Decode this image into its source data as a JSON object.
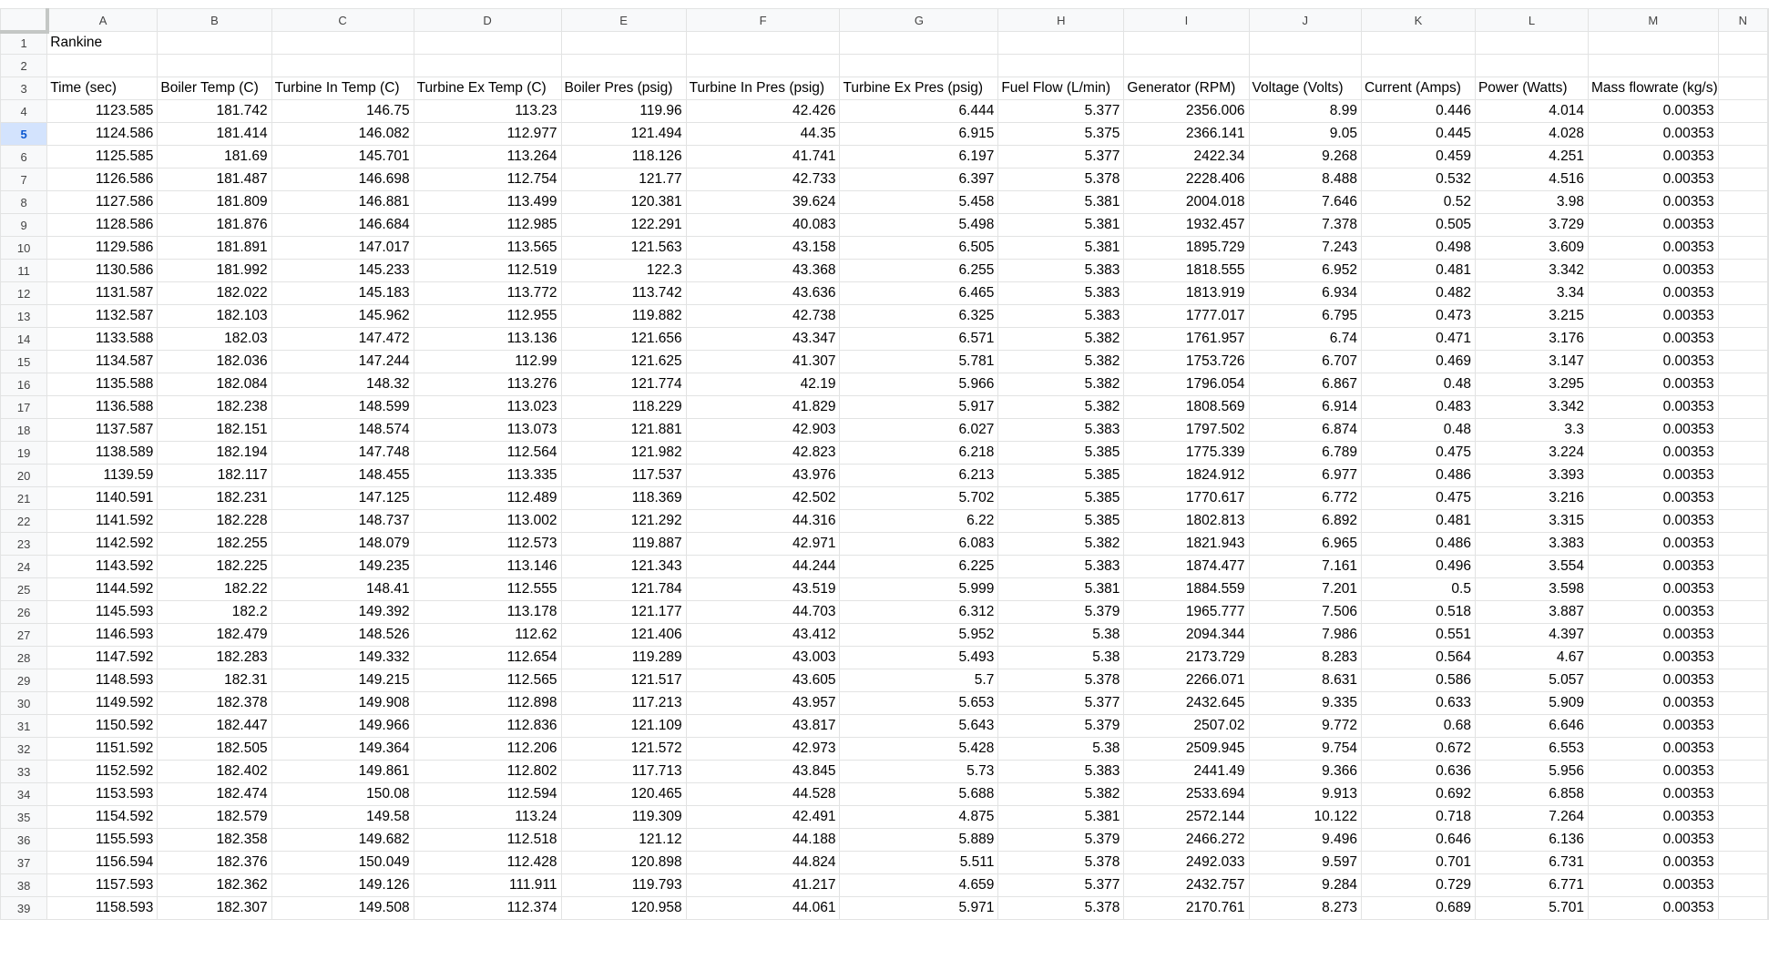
{
  "sheet": {
    "columns": [
      "A",
      "B",
      "C",
      "D",
      "E",
      "F",
      "G",
      "H",
      "I",
      "J",
      "K",
      "L",
      "M",
      "N"
    ],
    "selected_row": "5",
    "title_cell": "Rankine",
    "headers": [
      "Time (sec)",
      "Boiler Temp (C)",
      "Turbine In Temp (C)",
      "Turbine Ex Temp (C)",
      "Boiler Pres (psig)",
      "Turbine In Pres (psig)",
      "Turbine Ex Pres (psig)",
      "Fuel Flow (L/min)",
      "Generator (RPM)",
      "Voltage (Volts)",
      "Current (Amps)",
      "Power (Watts)",
      "Mass flowrate (kg/s)"
    ],
    "rows": [
      [
        "1123.585",
        "181.742",
        "146.75",
        "113.23",
        "119.96",
        "42.426",
        "6.444",
        "5.377",
        "2356.006",
        "8.99",
        "0.446",
        "4.014",
        "0.00353"
      ],
      [
        "1124.586",
        "181.414",
        "146.082",
        "112.977",
        "121.494",
        "44.35",
        "6.915",
        "5.375",
        "2366.141",
        "9.05",
        "0.445",
        "4.028",
        "0.00353"
      ],
      [
        "1125.585",
        "181.69",
        "145.701",
        "113.264",
        "118.126",
        "41.741",
        "6.197",
        "5.377",
        "2422.34",
        "9.268",
        "0.459",
        "4.251",
        "0.00353"
      ],
      [
        "1126.586",
        "181.487",
        "146.698",
        "112.754",
        "121.77",
        "42.733",
        "6.397",
        "5.378",
        "2228.406",
        "8.488",
        "0.532",
        "4.516",
        "0.00353"
      ],
      [
        "1127.586",
        "181.809",
        "146.881",
        "113.499",
        "120.381",
        "39.624",
        "5.458",
        "5.381",
        "2004.018",
        "7.646",
        "0.52",
        "3.98",
        "0.00353"
      ],
      [
        "1128.586",
        "181.876",
        "146.684",
        "112.985",
        "122.291",
        "40.083",
        "5.498",
        "5.381",
        "1932.457",
        "7.378",
        "0.505",
        "3.729",
        "0.00353"
      ],
      [
        "1129.586",
        "181.891",
        "147.017",
        "113.565",
        "121.563",
        "43.158",
        "6.505",
        "5.381",
        "1895.729",
        "7.243",
        "0.498",
        "3.609",
        "0.00353"
      ],
      [
        "1130.586",
        "181.992",
        "145.233",
        "112.519",
        "122.3",
        "43.368",
        "6.255",
        "5.383",
        "1818.555",
        "6.952",
        "0.481",
        "3.342",
        "0.00353"
      ],
      [
        "1131.587",
        "182.022",
        "145.183",
        "113.772",
        "113.742",
        "43.636",
        "6.465",
        "5.383",
        "1813.919",
        "6.934",
        "0.482",
        "3.34",
        "0.00353"
      ],
      [
        "1132.587",
        "182.103",
        "145.962",
        "112.955",
        "119.882",
        "42.738",
        "6.325",
        "5.383",
        "1777.017",
        "6.795",
        "0.473",
        "3.215",
        "0.00353"
      ],
      [
        "1133.588",
        "182.03",
        "147.472",
        "113.136",
        "121.656",
        "43.347",
        "6.571",
        "5.382",
        "1761.957",
        "6.74",
        "0.471",
        "3.176",
        "0.00353"
      ],
      [
        "1134.587",
        "182.036",
        "147.244",
        "112.99",
        "121.625",
        "41.307",
        "5.781",
        "5.382",
        "1753.726",
        "6.707",
        "0.469",
        "3.147",
        "0.00353"
      ],
      [
        "1135.588",
        "182.084",
        "148.32",
        "113.276",
        "121.774",
        "42.19",
        "5.966",
        "5.382",
        "1796.054",
        "6.867",
        "0.48",
        "3.295",
        "0.00353"
      ],
      [
        "1136.588",
        "182.238",
        "148.599",
        "113.023",
        "118.229",
        "41.829",
        "5.917",
        "5.382",
        "1808.569",
        "6.914",
        "0.483",
        "3.342",
        "0.00353"
      ],
      [
        "1137.587",
        "182.151",
        "148.574",
        "113.073",
        "121.881",
        "42.903",
        "6.027",
        "5.383",
        "1797.502",
        "6.874",
        "0.48",
        "3.3",
        "0.00353"
      ],
      [
        "1138.589",
        "182.194",
        "147.748",
        "112.564",
        "121.982",
        "42.823",
        "6.218",
        "5.385",
        "1775.339",
        "6.789",
        "0.475",
        "3.224",
        "0.00353"
      ],
      [
        "1139.59",
        "182.117",
        "148.455",
        "113.335",
        "117.537",
        "43.976",
        "6.213",
        "5.385",
        "1824.912",
        "6.977",
        "0.486",
        "3.393",
        "0.00353"
      ],
      [
        "1140.591",
        "182.231",
        "147.125",
        "112.489",
        "118.369",
        "42.502",
        "5.702",
        "5.385",
        "1770.617",
        "6.772",
        "0.475",
        "3.216",
        "0.00353"
      ],
      [
        "1141.592",
        "182.228",
        "148.737",
        "113.002",
        "121.292",
        "44.316",
        "6.22",
        "5.385",
        "1802.813",
        "6.892",
        "0.481",
        "3.315",
        "0.00353"
      ],
      [
        "1142.592",
        "182.255",
        "148.079",
        "112.573",
        "119.887",
        "42.971",
        "6.083",
        "5.382",
        "1821.943",
        "6.965",
        "0.486",
        "3.383",
        "0.00353"
      ],
      [
        "1143.592",
        "182.225",
        "149.235",
        "113.146",
        "121.343",
        "44.244",
        "6.225",
        "5.383",
        "1874.477",
        "7.161",
        "0.496",
        "3.554",
        "0.00353"
      ],
      [
        "1144.592",
        "182.22",
        "148.41",
        "112.555",
        "121.784",
        "43.519",
        "5.999",
        "5.381",
        "1884.559",
        "7.201",
        "0.5",
        "3.598",
        "0.00353"
      ],
      [
        "1145.593",
        "182.2",
        "149.392",
        "113.178",
        "121.177",
        "44.703",
        "6.312",
        "5.379",
        "1965.777",
        "7.506",
        "0.518",
        "3.887",
        "0.00353"
      ],
      [
        "1146.593",
        "182.479",
        "148.526",
        "112.62",
        "121.406",
        "43.412",
        "5.952",
        "5.38",
        "2094.344",
        "7.986",
        "0.551",
        "4.397",
        "0.00353"
      ],
      [
        "1147.592",
        "182.283",
        "149.332",
        "112.654",
        "119.289",
        "43.003",
        "5.493",
        "5.38",
        "2173.729",
        "8.283",
        "0.564",
        "4.67",
        "0.00353"
      ],
      [
        "1148.593",
        "182.31",
        "149.215",
        "112.565",
        "121.517",
        "43.605",
        "5.7",
        "5.378",
        "2266.071",
        "8.631",
        "0.586",
        "5.057",
        "0.00353"
      ],
      [
        "1149.592",
        "182.378",
        "149.908",
        "112.898",
        "117.213",
        "43.957",
        "5.653",
        "5.377",
        "2432.645",
        "9.335",
        "0.633",
        "5.909",
        "0.00353"
      ],
      [
        "1150.592",
        "182.447",
        "149.966",
        "112.836",
        "121.109",
        "43.817",
        "5.643",
        "5.379",
        "2507.02",
        "9.772",
        "0.68",
        "6.646",
        "0.00353"
      ],
      [
        "1151.592",
        "182.505",
        "149.364",
        "112.206",
        "121.572",
        "42.973",
        "5.428",
        "5.38",
        "2509.945",
        "9.754",
        "0.672",
        "6.553",
        "0.00353"
      ],
      [
        "1152.592",
        "182.402",
        "149.861",
        "112.802",
        "117.713",
        "43.845",
        "5.73",
        "5.383",
        "2441.49",
        "9.366",
        "0.636",
        "5.956",
        "0.00353"
      ],
      [
        "1153.593",
        "182.474",
        "150.08",
        "112.594",
        "120.465",
        "44.528",
        "5.688",
        "5.382",
        "2533.694",
        "9.913",
        "0.692",
        "6.858",
        "0.00353"
      ],
      [
        "1154.592",
        "182.579",
        "149.58",
        "113.24",
        "119.309",
        "42.491",
        "4.875",
        "5.381",
        "2572.144",
        "10.122",
        "0.718",
        "7.264",
        "0.00353"
      ],
      [
        "1155.593",
        "182.358",
        "149.682",
        "112.518",
        "121.12",
        "44.188",
        "5.889",
        "5.379",
        "2466.272",
        "9.496",
        "0.646",
        "6.136",
        "0.00353"
      ],
      [
        "1156.594",
        "182.376",
        "150.049",
        "112.428",
        "120.898",
        "44.824",
        "5.511",
        "5.378",
        "2492.033",
        "9.597",
        "0.701",
        "6.731",
        "0.00353"
      ],
      [
        "1157.593",
        "182.362",
        "149.126",
        "111.911",
        "119.793",
        "41.217",
        "4.659",
        "5.377",
        "2432.757",
        "9.284",
        "0.729",
        "6.771",
        "0.00353"
      ],
      [
        "1158.593",
        "182.307",
        "149.508",
        "112.374",
        "120.958",
        "44.061",
        "5.971",
        "5.378",
        "2170.761",
        "8.273",
        "0.689",
        "5.701",
        "0.00353"
      ]
    ]
  }
}
